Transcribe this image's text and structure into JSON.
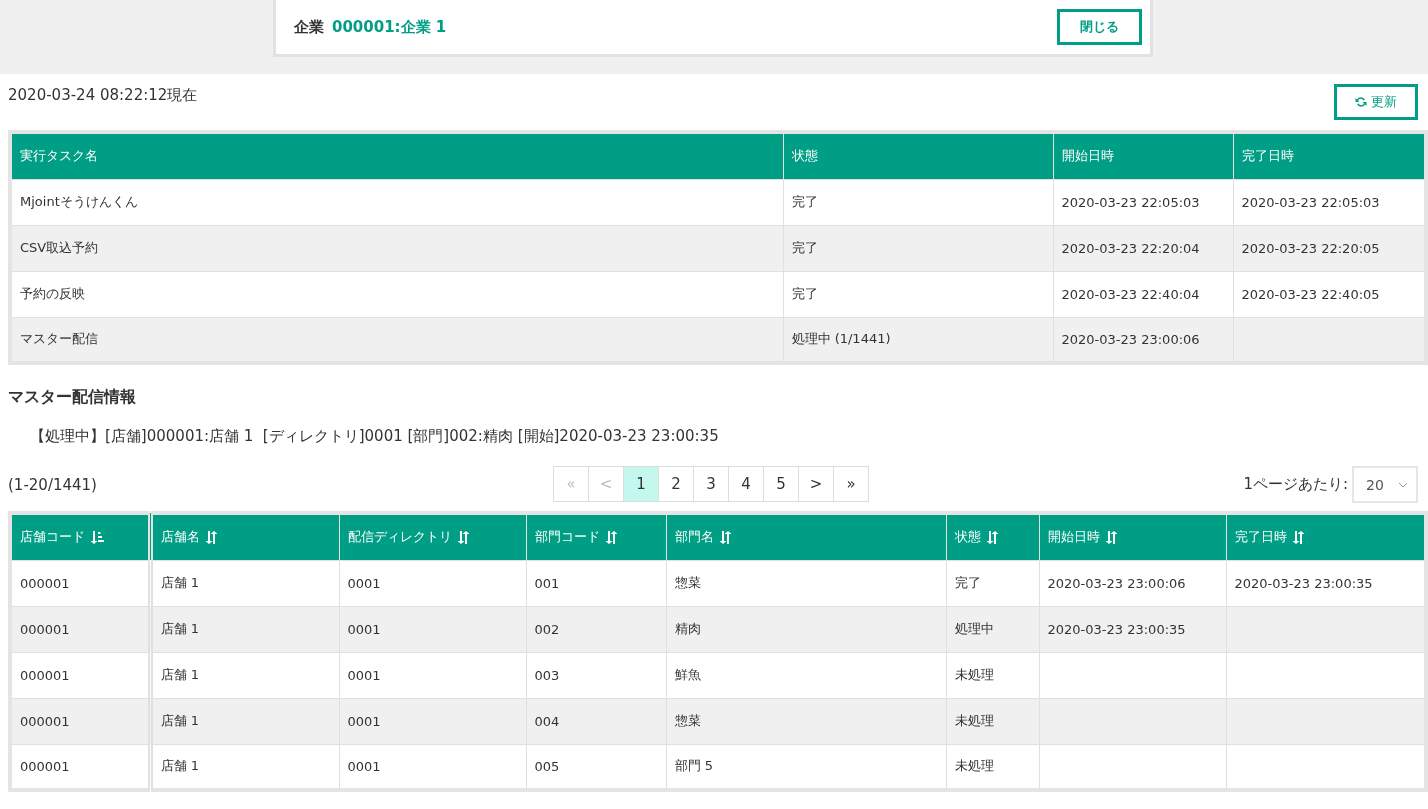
{
  "header": {
    "label": "企業",
    "company": "000001:企業 1",
    "close_button": "閉じる"
  },
  "timestamp": "2020-03-24 08:22:12現在",
  "refresh_button": "更新",
  "task_table": {
    "columns": [
      "実行タスク名",
      "状態",
      "開始日時",
      "完了日時"
    ],
    "rows": [
      [
        "Mjointそうけんくん",
        "完了",
        "2020-03-23 22:05:03",
        "2020-03-23 22:05:03"
      ],
      [
        "CSV取込予約",
        "完了",
        "2020-03-23 22:20:04",
        "2020-03-23 22:20:05"
      ],
      [
        "予約の反映",
        "完了",
        "2020-03-23 22:40:04",
        "2020-03-23 22:40:05"
      ],
      [
        "マスター配信",
        "処理中 (1/1441)",
        "2020-03-23 23:00:06",
        ""
      ]
    ]
  },
  "section_title": "マスター配信情報",
  "status_line": "【処理中】[店舗]000001:店舗 1  [ディレクトリ]0001 [部門]002:精肉 [開始]2020-03-23 23:00:35",
  "range": "(1-20/1441)",
  "pagination": [
    {
      "label": "«",
      "selected": false,
      "disabled": true
    },
    {
      "label": "<",
      "selected": false,
      "disabled": true
    },
    {
      "label": "1",
      "selected": true,
      "disabled": false
    },
    {
      "label": "2",
      "selected": false,
      "disabled": false
    },
    {
      "label": "3",
      "selected": false,
      "disabled": false
    },
    {
      "label": "4",
      "selected": false,
      "disabled": false
    },
    {
      "label": "5",
      "selected": false,
      "disabled": false
    },
    {
      "label": ">",
      "selected": false,
      "disabled": false
    },
    {
      "label": "»",
      "selected": false,
      "disabled": false
    }
  ],
  "per_page": {
    "label": "1ページあたり:",
    "value": "20"
  },
  "delivery_table": {
    "columns": [
      {
        "label": "店舗コード",
        "sorted": true
      },
      {
        "label": "店舗名",
        "sorted": false
      },
      {
        "label": "配信ディレクトリ",
        "sorted": false
      },
      {
        "label": "部門コード",
        "sorted": false
      },
      {
        "label": "部門名",
        "sorted": false
      },
      {
        "label": "状態",
        "sorted": false
      },
      {
        "label": "開始日時",
        "sorted": false
      },
      {
        "label": "完了日時",
        "sorted": false
      }
    ],
    "rows": [
      [
        "000001",
        "店舗 1",
        "0001",
        "001",
        "惣菜",
        "完了",
        "2020-03-23 23:00:06",
        "2020-03-23 23:00:35"
      ],
      [
        "000001",
        "店舗 1",
        "0001",
        "002",
        "精肉",
        "処理中",
        "2020-03-23 23:00:35",
        ""
      ],
      [
        "000001",
        "店舗 1",
        "0001",
        "003",
        "鮮魚",
        "未処理",
        "",
        ""
      ],
      [
        "000001",
        "店舗 1",
        "0001",
        "004",
        "惣菜",
        "未処理",
        "",
        ""
      ],
      [
        "000001",
        "店舗 1",
        "0001",
        "005",
        "部門 5",
        "未処理",
        "",
        ""
      ]
    ]
  }
}
